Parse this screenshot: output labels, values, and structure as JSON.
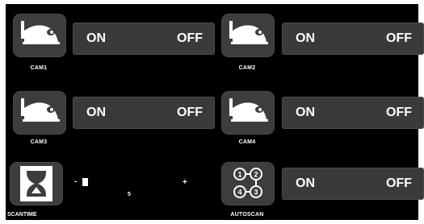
{
  "cameras": [
    {
      "label": "CAM1",
      "on_label": "ON",
      "off_label": "OFF",
      "icon": "security-camera-icon"
    },
    {
      "label": "CAM2",
      "on_label": "ON",
      "off_label": "OFF",
      "icon": "security-camera-icon"
    },
    {
      "label": "CAM3",
      "on_label": "ON",
      "off_label": "OFF",
      "icon": "security-camera-icon"
    },
    {
      "label": "CAM4",
      "on_label": "ON",
      "off_label": "OFF",
      "icon": "security-camera-icon"
    }
  ],
  "scantime": {
    "label": "SCANTIME",
    "icon": "hourglass-icon",
    "minus": "-",
    "plus": "+",
    "value": "5"
  },
  "autoscan": {
    "label": "AUTOSCAN",
    "icon": "autoscan-sequence-icon",
    "on_label": "ON",
    "off_label": "OFF"
  },
  "colors": {
    "background": "#000000",
    "tile": "#3d3d3d",
    "toggle": "#3a3a3a",
    "text": "#ffffff"
  }
}
